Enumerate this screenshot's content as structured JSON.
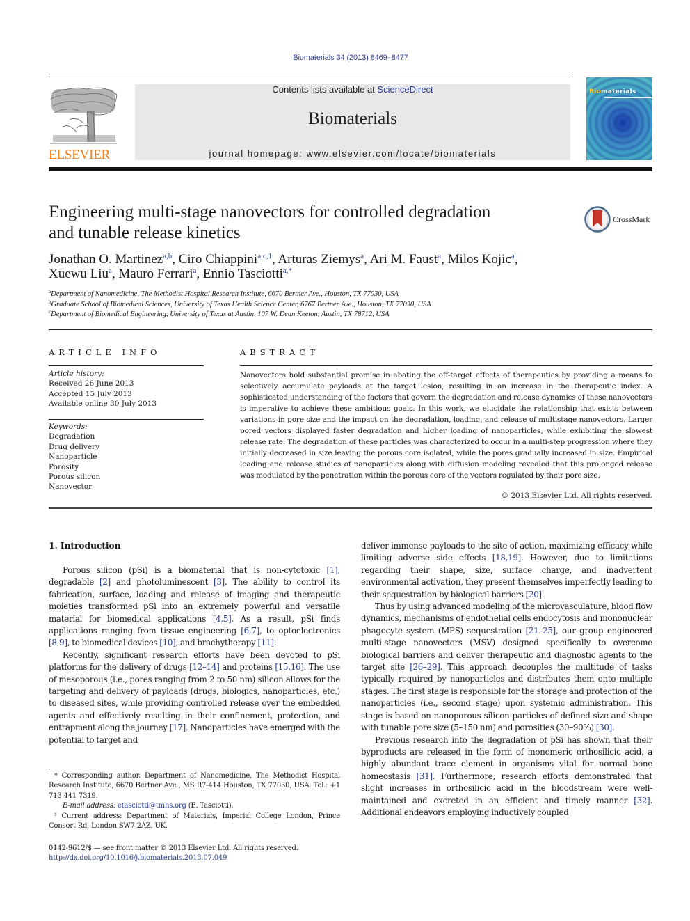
{
  "header": {
    "citation": "Biomaterials 34 (2013) 8469–8477",
    "contents_prefix": "Contents lists available at ",
    "contents_link": "ScienceDirect",
    "journal_name": "Biomaterials",
    "homepage_prefix": "journal homepage: ",
    "homepage_url": "www.elsevier.com/locate/biomaterials",
    "publisher_logo_text": "ELSEVIER",
    "cover_title_highlight": "Bio",
    "cover_title_rest": "materials"
  },
  "colors": {
    "link": "#2a3d8f",
    "publisher_orange": "#f07d13",
    "masthead_bg": "#e8e8e8",
    "crossmark_red": "#c8372d"
  },
  "article": {
    "title_line1": "Engineering multi-stage nanovectors for controlled degradation",
    "title_line2": "and tunable release kinetics",
    "crossmark_label": "CrossMark",
    "authors": [
      {
        "name": "Jonathan O. Martinez",
        "sup": "a,b",
        "sep": ", "
      },
      {
        "name": "Ciro Chiappini",
        "sup": "a,c,1",
        "sep": ", "
      },
      {
        "name": "Arturas Ziemys",
        "sup": "a",
        "sep": ", "
      },
      {
        "name": "Ari M. Faust",
        "sup": "a",
        "sep": ", "
      },
      {
        "name": "Milos Kojic",
        "sup": "a",
        "sep": ","
      },
      {
        "name": "Xuewu Liu",
        "sup": "a",
        "sep": ", "
      },
      {
        "name": "Mauro Ferrari",
        "sup": "a",
        "sep": ", "
      },
      {
        "name": "Ennio Tasciotti",
        "sup": "a,*",
        "sep": ""
      }
    ],
    "affiliations": [
      {
        "key": "a",
        "text": "Department of Nanomedicine, The Methodist Hospital Research Institute, 6670 Bertner Ave., Houston, TX 77030, USA"
      },
      {
        "key": "b",
        "text": "Graduate School of Biomedical Sciences, University of Texas Health Science Center, 6767 Bertner Ave., Houston, TX 77030, USA"
      },
      {
        "key": "c",
        "text": "Department of Biomedical Engineering, University of Texas at Austin, 107 W. Dean Keeton, Austin, TX 78712, USA"
      }
    ]
  },
  "article_info": {
    "heading": "ARTICLE INFO",
    "history_label": "Article history:",
    "history": [
      "Received 26 June 2013",
      "Accepted 15 July 2013",
      "Available online 30 July 2013"
    ],
    "keywords_label": "Keywords:",
    "keywords": [
      "Degradation",
      "Drug delivery",
      "Nanoparticle",
      "Porosity",
      "Porous silicon",
      "Nanovector"
    ]
  },
  "abstract": {
    "heading": "ABSTRACT",
    "text": "Nanovectors hold substantial promise in abating the off-target effects of therapeutics by providing a means to selectively accumulate payloads at the target lesion, resulting in an increase in the therapeutic index. A sophisticated understanding of the factors that govern the degradation and release dynamics of these nanovectors is imperative to achieve these ambitious goals. In this work, we elucidate the relationship that exists between variations in pore size and the impact on the degradation, loading, and release of multistage nanovectors. Larger pored vectors displayed faster degradation and higher loading of nanoparticles, while exhibiting the slowest release rate. The degradation of these particles was characterized to occur in a multi-step progression where they initially decreased in size leaving the porous core isolated, while the pores gradually increased in size. Empirical loading and release studies of nanoparticles along with diffusion modeling revealed that this prolonged release was modulated by the penetration within the porous core of the vectors regulated by their pore size.",
    "copyright": "© 2013 Elsevier Ltd. All rights reserved."
  },
  "body": {
    "section_heading": "1.  Introduction",
    "left_paragraphs": [
      [
        {
          "t": "Porous silicon (pSi) is a biomaterial that is non-cytotoxic "
        },
        {
          "r": "[1]"
        },
        {
          "t": ", degradable "
        },
        {
          "r": "[2]"
        },
        {
          "t": " and photoluminescent "
        },
        {
          "r": "[3]"
        },
        {
          "t": ". The ability to control its fabrication, surface, loading and release of imaging and therapeutic moieties transformed pSi into an extremely powerful and versatile material for biomedical applications "
        },
        {
          "r": "[4,5]"
        },
        {
          "t": ". As a result, pSi finds applications ranging from tissue engineering "
        },
        {
          "r": "[6,7]"
        },
        {
          "t": ", to optoelectronics "
        },
        {
          "r": "[8,9]"
        },
        {
          "t": ", to biomedical devices "
        },
        {
          "r": "[10]"
        },
        {
          "t": ", and brachytherapy "
        },
        {
          "r": "[11]"
        },
        {
          "t": "."
        }
      ],
      [
        {
          "t": "Recently, significant research efforts have been devoted to pSi platforms for the delivery of drugs "
        },
        {
          "r": "[12–14]"
        },
        {
          "t": " and proteins "
        },
        {
          "r": "[15,16]"
        },
        {
          "t": ". The use of mesoporous (i.e., pores ranging from 2 to 50 nm) silicon allows for the targeting and delivery of payloads (drugs, biologics, nanoparticles, etc.) to diseased sites, while providing controlled release over the embedded agents and effectively resulting in their confinement, protection, and entrapment along the journey "
        },
        {
          "r": "[17]"
        },
        {
          "t": ". Nanoparticles have emerged with the potential to target and"
        }
      ]
    ],
    "right_paragraphs": [
      [
        {
          "t": "deliver immense payloads to the site of action, maximizing efficacy while limiting adverse side effects "
        },
        {
          "r": "[18,19]"
        },
        {
          "t": ". However, due to limitations regarding their shape, size, surface charge, and inadvertent environmental activation, they present themselves imperfectly leading to their sequestration by biological barriers "
        },
        {
          "r": "[20]"
        },
        {
          "t": "."
        }
      ],
      [
        {
          "t": "Thus by using advanced modeling of the microvasculature, blood flow dynamics, mechanisms of endothelial cells endocytosis and mononuclear phagocyte system (MPS) sequestration "
        },
        {
          "r": "[21–25]"
        },
        {
          "t": ", our group engineered multi-stage nanovectors (MSV) designed specifically to overcome biological barriers and deliver therapeutic and diagnostic agents to the target site "
        },
        {
          "r": "[26–29]"
        },
        {
          "t": ". This approach decouples the multitude of tasks typically required by nanoparticles and distributes them onto multiple stages. The first stage is responsible for the storage and protection of the nanoparticles (i.e., second stage) upon systemic administration. This stage is based on nanoporous silicon particles of defined size and shape with tunable pore size (5–150 nm) and porosities (30–90%) "
        },
        {
          "r": "[30]"
        },
        {
          "t": "."
        }
      ],
      [
        {
          "t": "Previous research into the degradation of pSi has shown that their byproducts are released in the form of monomeric orthosilicic acid, a highly abundant trace element in organisms vital for normal bone homeostasis "
        },
        {
          "r": "[31]"
        },
        {
          "t": ". Furthermore, research efforts demonstrated that slight increases in orthosilicic acid in the bloodstream were well-maintained and excreted in an efficient and timely manner "
        },
        {
          "r": "[32]"
        },
        {
          "t": ". Additional endeavors employing inductively coupled"
        }
      ]
    ]
  },
  "footnotes": {
    "corresponding": "* Corresponding author. Department of Nanomedicine, The Methodist Hospital Research Institute, 6670 Bertner Ave., MS R7-414 Houston, TX 77030, USA. Tel.: +1 713 441 7319.",
    "email_label": "E-mail address: ",
    "email": "etasciotti@tmhs.org",
    "email_suffix": " (E. Tasciotti).",
    "note1": "¹ Current address: Department of Materials, Imperial College London, Prince Consort Rd, London SW7 2AZ, UK."
  },
  "front_matter": {
    "issn_line": "0142-9612/$ — see front matter © 2013 Elsevier Ltd. All rights reserved.",
    "doi": "http://dx.doi.org/10.1016/j.biomaterials.2013.07.049"
  }
}
